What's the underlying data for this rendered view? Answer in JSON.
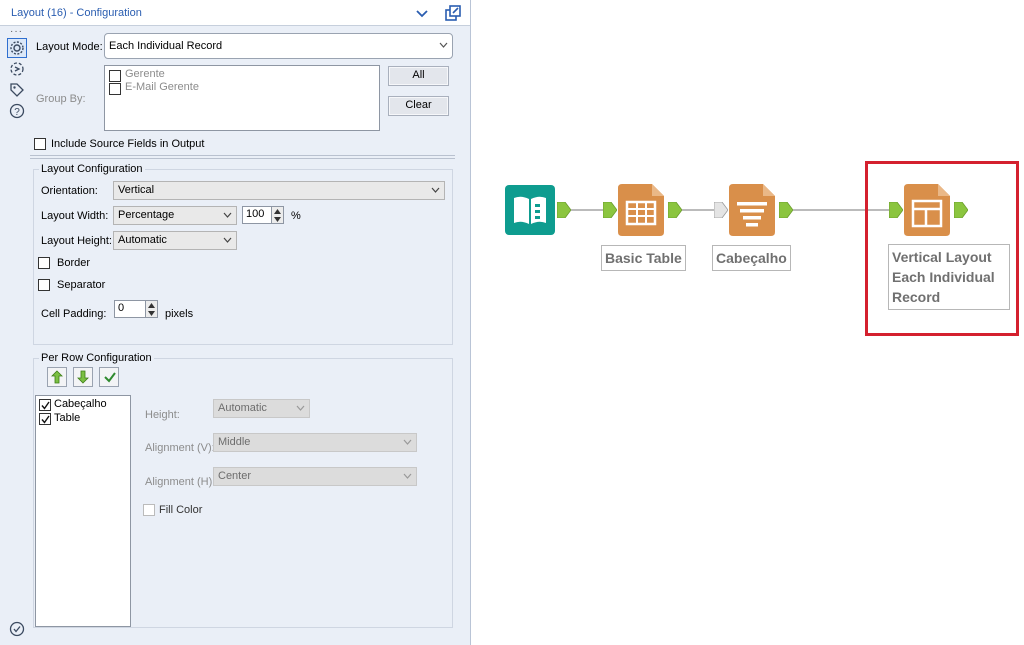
{
  "panel": {
    "title": "Layout (16) - Configuration",
    "layout_mode_label": "Layout Mode:",
    "layout_mode_value": "Each Individual Record",
    "group_by_label": "Group By:",
    "group_by_items": [
      "Gerente",
      "E-Mail Gerente"
    ],
    "all_button": "All",
    "clear_button": "Clear",
    "include_source_label": "Include Source Fields in Output",
    "layout_config": {
      "title": "Layout Configuration",
      "orientation_label": "Orientation:",
      "orientation_value": "Vertical",
      "width_label": "Layout Width:",
      "width_value": "Percentage",
      "width_number": "100",
      "width_unit": "%",
      "height_label": "Layout Height:",
      "height_value": "Automatic",
      "border_label": "Border",
      "separator_label": "Separator",
      "padding_label": "Cell Padding:",
      "padding_value": "0",
      "padding_unit": "pixels"
    },
    "row_config": {
      "title": "Per Row Configuration",
      "rows": [
        "Cabeçalho",
        "Table"
      ],
      "height_label": "Height:",
      "height_value": "Automatic",
      "align_v_label": "Alignment (V):",
      "align_v_value": "Middle",
      "align_h_label": "Alignment (H):",
      "align_h_value": "Center",
      "fill_color_label": "Fill Color"
    }
  },
  "canvas": {
    "tools": [
      {
        "name": "input",
        "label": ""
      },
      {
        "name": "basic-table",
        "label": "Basic Table"
      },
      {
        "name": "cabecalho",
        "label": "Cabeçalho"
      },
      {
        "name": "layout",
        "label": "Vertical Layout Each Individual Record"
      }
    ],
    "colors": {
      "input": "#0e9c8f",
      "reporting": "#d98f4a",
      "connector": "#8bc53f",
      "highlight": "#d4202e"
    }
  }
}
